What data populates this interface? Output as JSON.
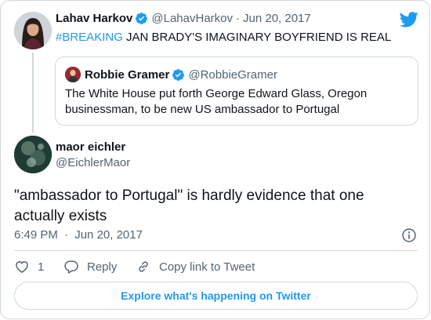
{
  "colors": {
    "brand_blue": "#1d9bf0",
    "text": "#0f1419",
    "muted": "#536471",
    "border": "#cfd9de"
  },
  "parent_tweet": {
    "author_name": "Lahav Harkov",
    "author_handle": "@LahavHarkov",
    "separator": "·",
    "date": "Jun 20, 2017",
    "hashtag": "#BREAKING",
    "text": " JAN BRADY'S IMAGINARY BOYFRIEND IS REAL",
    "verified_icon": "verified-badge-icon"
  },
  "quoted_tweet": {
    "author_name": "Robbie Gramer",
    "author_handle": "@RobbieGramer",
    "text": "The White House put forth George Edward Glass, Oregon businessman, to be new US ambassador to Portugal"
  },
  "main_tweet": {
    "author_name": "maor eichler",
    "author_handle": "@EichlerMaor",
    "text": "\"ambassador to Portugal\" is hardly evidence that one actually exists",
    "time": "6:49 PM",
    "separator": "·",
    "date": "Jun 20, 2017"
  },
  "actions": {
    "like_count": "1",
    "reply_label": "Reply",
    "copy_link_label": "Copy link to Tweet"
  },
  "explore_label": "Explore what's happening on Twitter",
  "icons": [
    "twitter-bird-icon",
    "verified-badge-icon",
    "heart-icon",
    "reply-icon",
    "link-icon",
    "info-icon"
  ]
}
